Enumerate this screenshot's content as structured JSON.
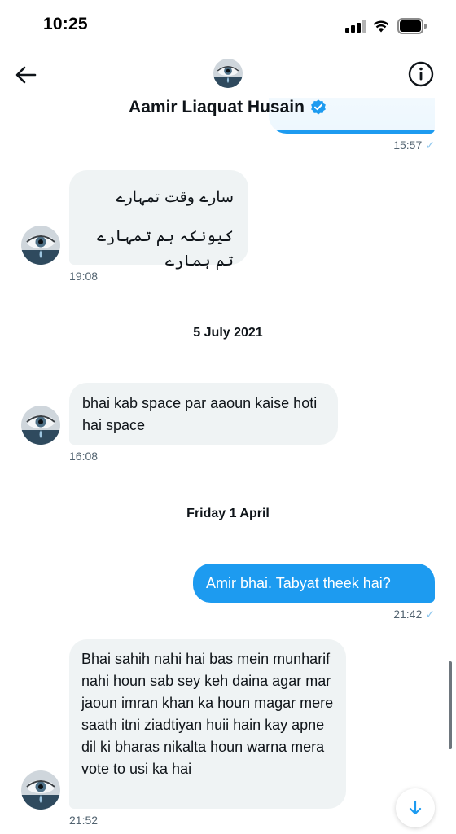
{
  "status_bar": {
    "time": "10:25"
  },
  "header": {
    "name": "Aamir Liaquat Husain",
    "verified": true,
    "accent": "#1d9bf0"
  },
  "messages": {
    "top_partial": {
      "time": "15:57"
    },
    "urdu_poem": {
      "line1": "سارے وقت تمہارے",
      "line2": "کیونکہ ہم تمہارے تم ہمارے",
      "time": "19:08"
    },
    "date1": "5 July 2021",
    "msg_space": {
      "text": "bhai kab space par aaoun kaise hoti hai space",
      "time": "16:08"
    },
    "date2": "Friday 1 April",
    "msg_out": {
      "text": "Amir bhai. Tabyat theek hai?",
      "time": "21:42"
    },
    "msg_reply": {
      "text": "Bhai sahih nahi hai bas mein munharif nahi houn sab sey keh daina agar mar jaoun imran khan ka houn magar mere saath itni ziadtiyan huii hain kay apne dil ki bharas nikalta houn warna mera vote to usi ka hai",
      "time": "21:52"
    }
  },
  "colors": {
    "bubble_in": "#eff3f4",
    "bubble_out": "#1d9bf0",
    "secondary_text": "#536471"
  }
}
